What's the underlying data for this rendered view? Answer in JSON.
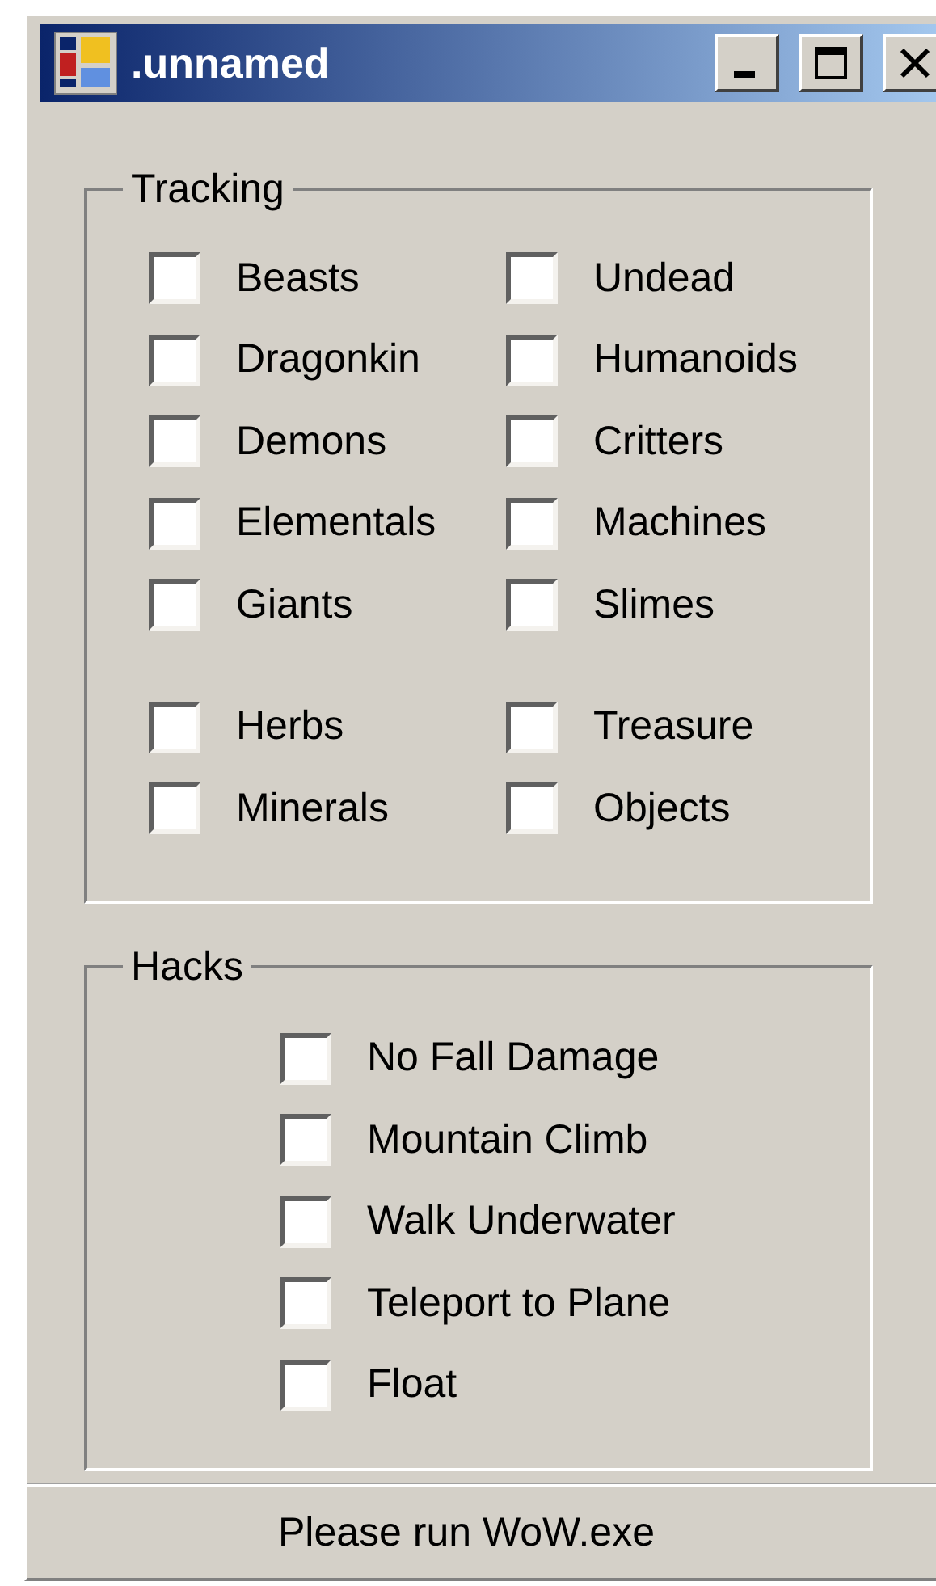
{
  "window": {
    "title": ".unnamed"
  },
  "tracking": {
    "title": "Tracking",
    "sections": [
      {
        "items": [
          {
            "label": "Beasts",
            "checked": false
          },
          {
            "label": "Undead",
            "checked": false
          },
          {
            "label": "Dragonkin",
            "checked": false
          },
          {
            "label": "Humanoids",
            "checked": false
          },
          {
            "label": "Demons",
            "checked": false
          },
          {
            "label": "Critters",
            "checked": false
          },
          {
            "label": "Elementals",
            "checked": false
          },
          {
            "label": "Machines",
            "checked": false
          },
          {
            "label": "Giants",
            "checked": false
          },
          {
            "label": "Slimes",
            "checked": false
          }
        ]
      },
      {
        "items": [
          {
            "label": "Herbs",
            "checked": false
          },
          {
            "label": "Treasure",
            "checked": false
          },
          {
            "label": "Minerals",
            "checked": false
          },
          {
            "label": "Objects",
            "checked": false
          }
        ]
      }
    ]
  },
  "hacks": {
    "title": "Hacks",
    "items": [
      {
        "label": "No Fall Damage",
        "checked": false
      },
      {
        "label": "Mountain Climb",
        "checked": false
      },
      {
        "label": "Walk Underwater",
        "checked": false
      },
      {
        "label": "Teleport to Plane",
        "checked": false
      },
      {
        "label": "Float",
        "checked": false
      }
    ]
  },
  "status_bar": {
    "text": "Please run WoW.exe"
  }
}
